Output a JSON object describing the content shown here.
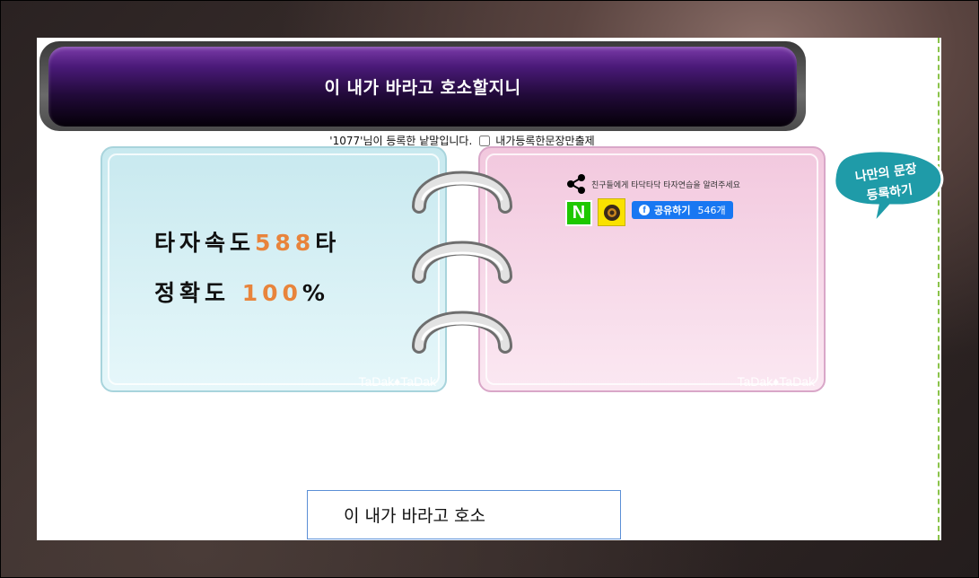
{
  "sentence": {
    "title": "이 내가 바라고 호소할지니",
    "author_prefix": "'1077'님이 등록한 낱말입니다.",
    "own_only_label": "내가등록한문장만출제"
  },
  "result": {
    "speed_label": "타자속도",
    "speed_value": "588",
    "speed_unit": "타",
    "accuracy_label": "정확도",
    "accuracy_value": "100",
    "accuracy_unit": "%",
    "watermark": "TaDak♦TaDak"
  },
  "share": {
    "message": "친구들에게 타닥타닥 타자연습을 알려주세요",
    "naver_label": "N",
    "facebook_label": "공유하기",
    "facebook_count": "546개",
    "watermark": "TaDak♦TaDak"
  },
  "bubble": {
    "line1": "나만의 문장",
    "line2": "등록하기"
  },
  "typing": {
    "value": "이 내가 바라고 호소"
  },
  "colors": {
    "accent_orange": "#e8843c",
    "title_purple": "#4a1a78",
    "facebook_blue": "#1877f2",
    "naver_green": "#1ec800",
    "kakao_yellow": "#fae100"
  }
}
